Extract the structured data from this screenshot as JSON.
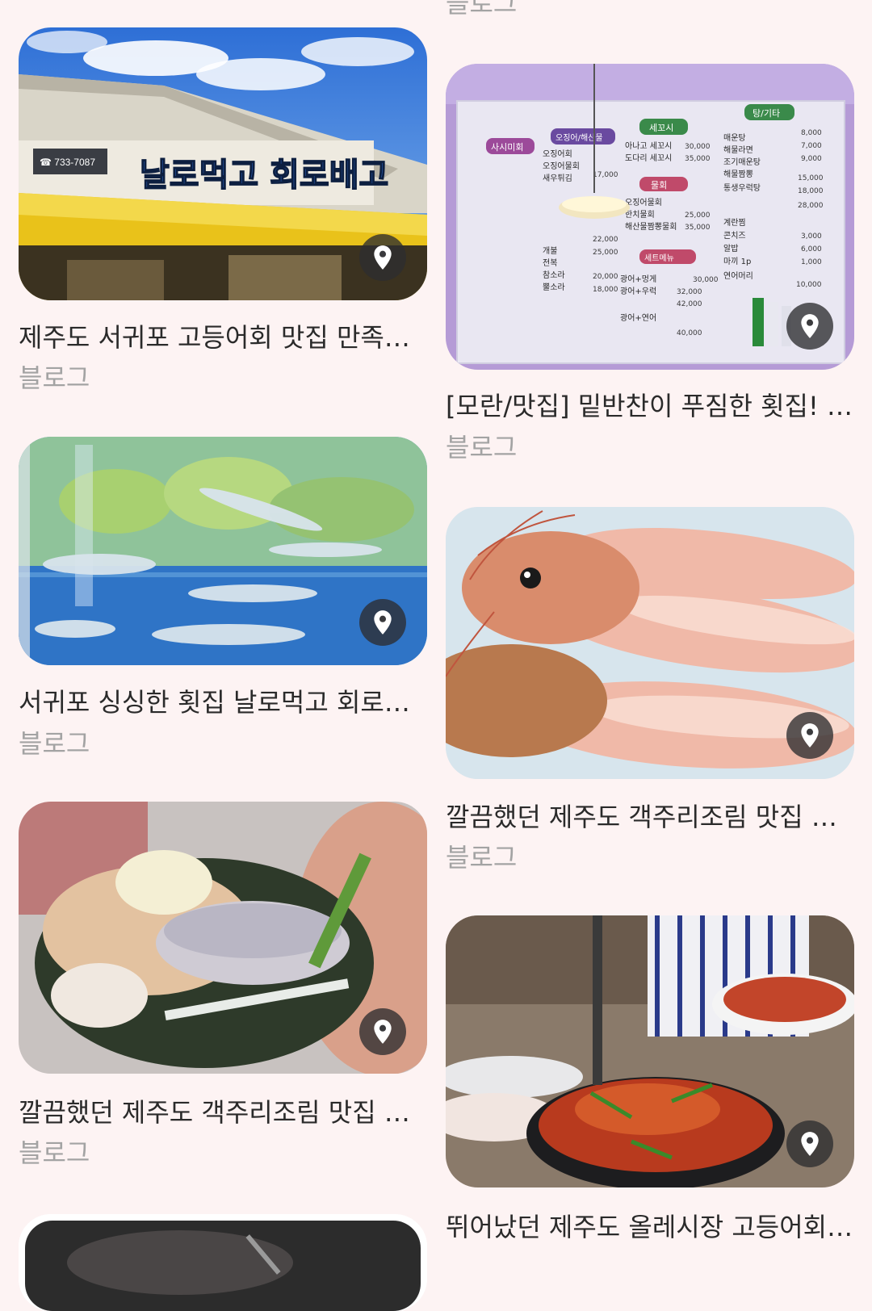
{
  "feed": {
    "colors": {
      "background": "#fdf3f3",
      "title_text": "#2a2a2a",
      "source_text": "#a3a3a3",
      "pin_button": "#2d2d30"
    },
    "top_partial": {
      "source": "블로그"
    },
    "left": [
      {
        "title": "제주도 서귀포 고등어회 맛집 만족스러웠던 날로먹고 회로배고",
        "source": "블로그",
        "image_icon": "map-pin-icon",
        "signboard": {
          "phone": "☎ 733-7087",
          "name": "날로먹고 회로배고"
        }
      },
      {
        "title": "서귀포 싱싱한 횟집 날로먹고 회로배고",
        "source": "블로그",
        "image_icon": "map-pin-icon"
      },
      {
        "title": "깔끔했던 제주도 객주리조림 맛집 날로먹고 회로배고",
        "source": "블로그",
        "image_icon": "map-pin-icon"
      },
      {
        "title": "",
        "source": ""
      }
    ],
    "right": [
      {
        "title": "[모란/맛집] 밑반찬이 푸짐한 횟집! 날로먹고 회로배고",
        "source": "블로그",
        "image_icon": "map-pin-icon",
        "menu_board": {
          "headings": [
            "사시미회",
            "오징어/해산물",
            "세꼬시",
            "탕/기타",
            "물회",
            "세트메뉴"
          ],
          "items": [
            "오징어회",
            "오징어물회",
            "새우튀김",
            "개불",
            "전복",
            "참소라",
            "뿔소라",
            "광어+멍게",
            "광어+우럭",
            "광어+연어",
            "아나고 세꼬시",
            "도다리 세꼬시",
            "오징어물회",
            "한치물회",
            "해산물짬뽕물회",
            "매운탕",
            "해물라면",
            "조기매운탕",
            "해물짬뽕",
            "통생우럭탕",
            "계란찜",
            "콘치즈",
            "알밥",
            "마끼 1p",
            "연어머리"
          ],
          "prices": [
            "30,000",
            "35,000",
            "25,000",
            "35,000",
            "30,000",
            "32,000",
            "42,000",
            "40,000",
            "17,000",
            "22,000",
            "25,000",
            "20,000",
            "18,000",
            "8,000",
            "7,000",
            "9,000",
            "15,000",
            "18,000",
            "28,000",
            "3,000",
            "6,000",
            "1,000",
            "10,000"
          ]
        }
      },
      {
        "title": "깔끔했던 제주도 객주리조림 맛집 날로먹고 회로배고",
        "source": "블로그",
        "image_icon": "map-pin-icon"
      },
      {
        "title": "뛰어났던 제주도 올레시장 고등어회 맛집",
        "source": "블로그",
        "image_icon": "map-pin-icon"
      }
    ]
  }
}
